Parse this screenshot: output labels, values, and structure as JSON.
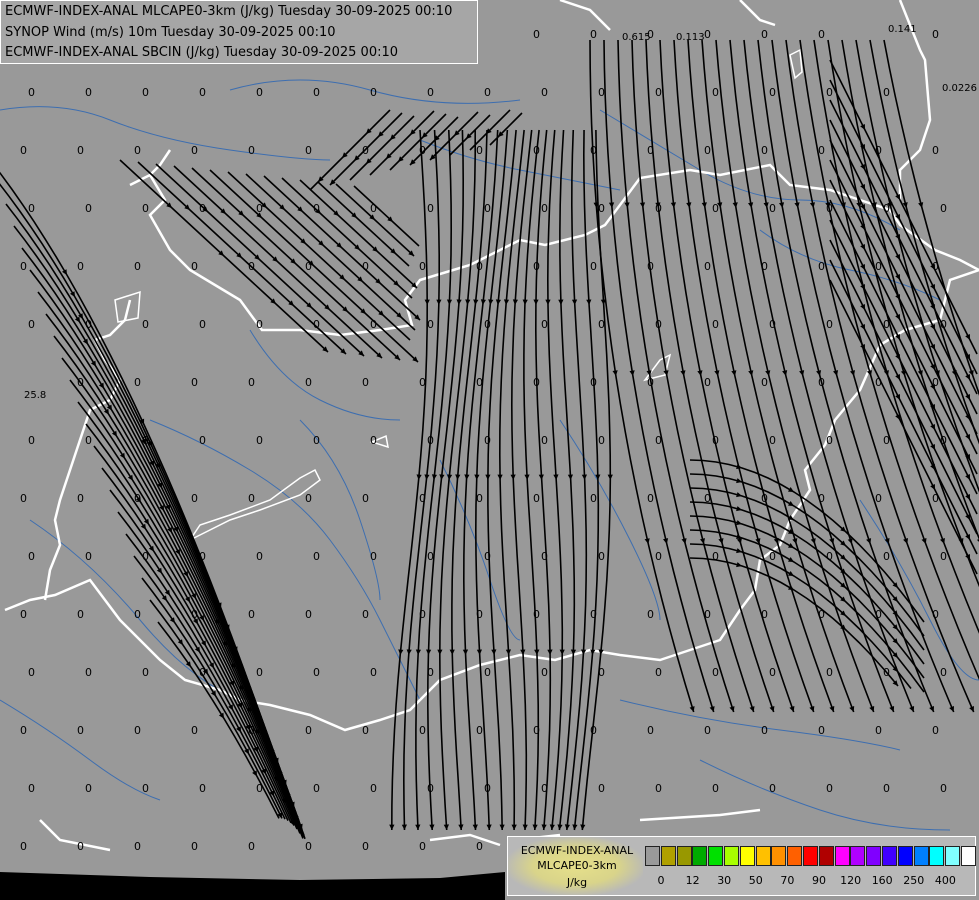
{
  "header": {
    "line1": "ECMWF-INDEX-ANAL MLCAPE0-3km (J/kg) Tuesday 30-09-2025 00:10",
    "line2": "SYNOP Wind (m/s) 10m Tuesday 30-09-2025 00:10",
    "line3": "ECMWF-INDEX-ANAL SBCIN (J/kg) Tuesday 30-09-2025 00:10"
  },
  "legend": {
    "title_line1": "ECMWF-INDEX-ANAL",
    "title_line2": "MLCAPE0-3km",
    "unit": "J/kg",
    "colors": [
      "#9a9a9a",
      "#b0a000",
      "#989800",
      "#00aa00",
      "#00e000",
      "#a8ff00",
      "#ffff00",
      "#ffc000",
      "#ff9000",
      "#ff6000",
      "#ff0000",
      "#b00000",
      "#ff00ff",
      "#b000ff",
      "#8000ff",
      "#4000ff",
      "#0000ff",
      "#0080ff",
      "#00ffff",
      "#80ffff",
      "#ffffff"
    ],
    "tick_labels": [
      "0",
      "12",
      "30",
      "50",
      "70",
      "90",
      "120",
      "160",
      "250",
      "400"
    ]
  },
  "map": {
    "background": "#999999",
    "special_values": [
      "0.615",
      "0.113",
      "0.141",
      "0.0226",
      "25.8"
    ]
  }
}
